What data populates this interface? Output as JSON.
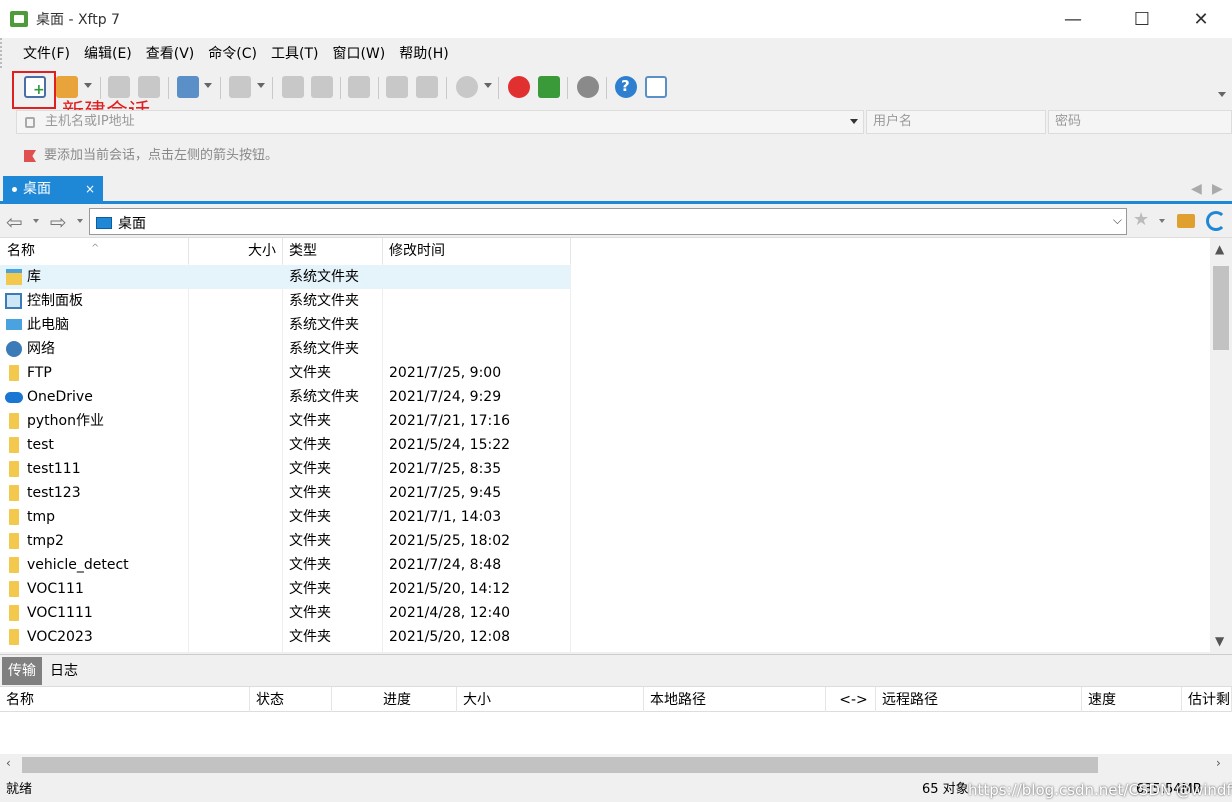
{
  "window": {
    "title": "桌面 - Xftp 7",
    "minimize": "—",
    "maximize": "☐",
    "close": "✕"
  },
  "menu": [
    "文件(F)",
    "编辑(E)",
    "查看(V)",
    "命令(C)",
    "工具(T)",
    "窗口(W)",
    "帮助(H)"
  ],
  "annotation": {
    "text": "新建会话",
    "color": "#e02020"
  },
  "connect": {
    "host_placeholder": "主机名或IP地址",
    "user_placeholder": "用户名",
    "password_placeholder": "密码"
  },
  "hint": "要添加当前会话，点击左侧的箭头按钮。",
  "tab": {
    "label": "桌面",
    "close": "×"
  },
  "path": {
    "value": "桌面"
  },
  "columns": {
    "name": "名称",
    "size": "大小",
    "type": "类型",
    "modified": "修改时间"
  },
  "files": [
    {
      "name": "库",
      "size": "",
      "type": "系统文件夹",
      "modified": "",
      "icon": "library-icon",
      "selected": true
    },
    {
      "name": "控制面板",
      "size": "",
      "type": "系统文件夹",
      "modified": "",
      "icon": "control-panel-icon"
    },
    {
      "name": "此电脑",
      "size": "",
      "type": "系统文件夹",
      "modified": "",
      "icon": "computer-icon"
    },
    {
      "name": "网络",
      "size": "",
      "type": "系统文件夹",
      "modified": "",
      "icon": "network-icon"
    },
    {
      "name": "FTP",
      "size": "",
      "type": "文件夹",
      "modified": "2021/7/25, 9:00",
      "icon": "folder-icon"
    },
    {
      "name": "OneDrive",
      "size": "",
      "type": "系统文件夹",
      "modified": "2021/7/24, 9:29",
      "icon": "onedrive-icon"
    },
    {
      "name": "python作业",
      "size": "",
      "type": "文件夹",
      "modified": "2021/7/21, 17:16",
      "icon": "folder-icon"
    },
    {
      "name": "test",
      "size": "",
      "type": "文件夹",
      "modified": "2021/5/24, 15:22",
      "icon": "folder-icon"
    },
    {
      "name": "test111",
      "size": "",
      "type": "文件夹",
      "modified": "2021/7/25, 8:35",
      "icon": "folder-icon"
    },
    {
      "name": "test123",
      "size": "",
      "type": "文件夹",
      "modified": "2021/7/25, 9:45",
      "icon": "folder-icon"
    },
    {
      "name": "tmp",
      "size": "",
      "type": "文件夹",
      "modified": "2021/7/1, 14:03",
      "icon": "folder-icon"
    },
    {
      "name": "tmp2",
      "size": "",
      "type": "文件夹",
      "modified": "2021/5/25, 18:02",
      "icon": "folder-icon"
    },
    {
      "name": "vehicle_detect",
      "size": "",
      "type": "文件夹",
      "modified": "2021/7/24, 8:48",
      "icon": "folder-icon"
    },
    {
      "name": "VOC111",
      "size": "",
      "type": "文件夹",
      "modified": "2021/5/20, 14:12",
      "icon": "folder-icon"
    },
    {
      "name": "VOC1111",
      "size": "",
      "type": "文件夹",
      "modified": "2021/4/28, 12:40",
      "icon": "folder-icon"
    },
    {
      "name": "VOC2023",
      "size": "",
      "type": "文件夹",
      "modified": "2021/5/20, 12:08",
      "icon": "folder-icon"
    }
  ],
  "bottom_tabs": [
    "传输",
    "日志"
  ],
  "transfer_columns": [
    "名称",
    "状态",
    "进度",
    "大小",
    "本地路径",
    "<->",
    "远程路径",
    "速度",
    "估计剩"
  ],
  "status": {
    "left": "就绪",
    "objects": "65 对象",
    "size": "635.54MB"
  },
  "watermark": "https://blog.csdn.net/CSDN @windfighting"
}
